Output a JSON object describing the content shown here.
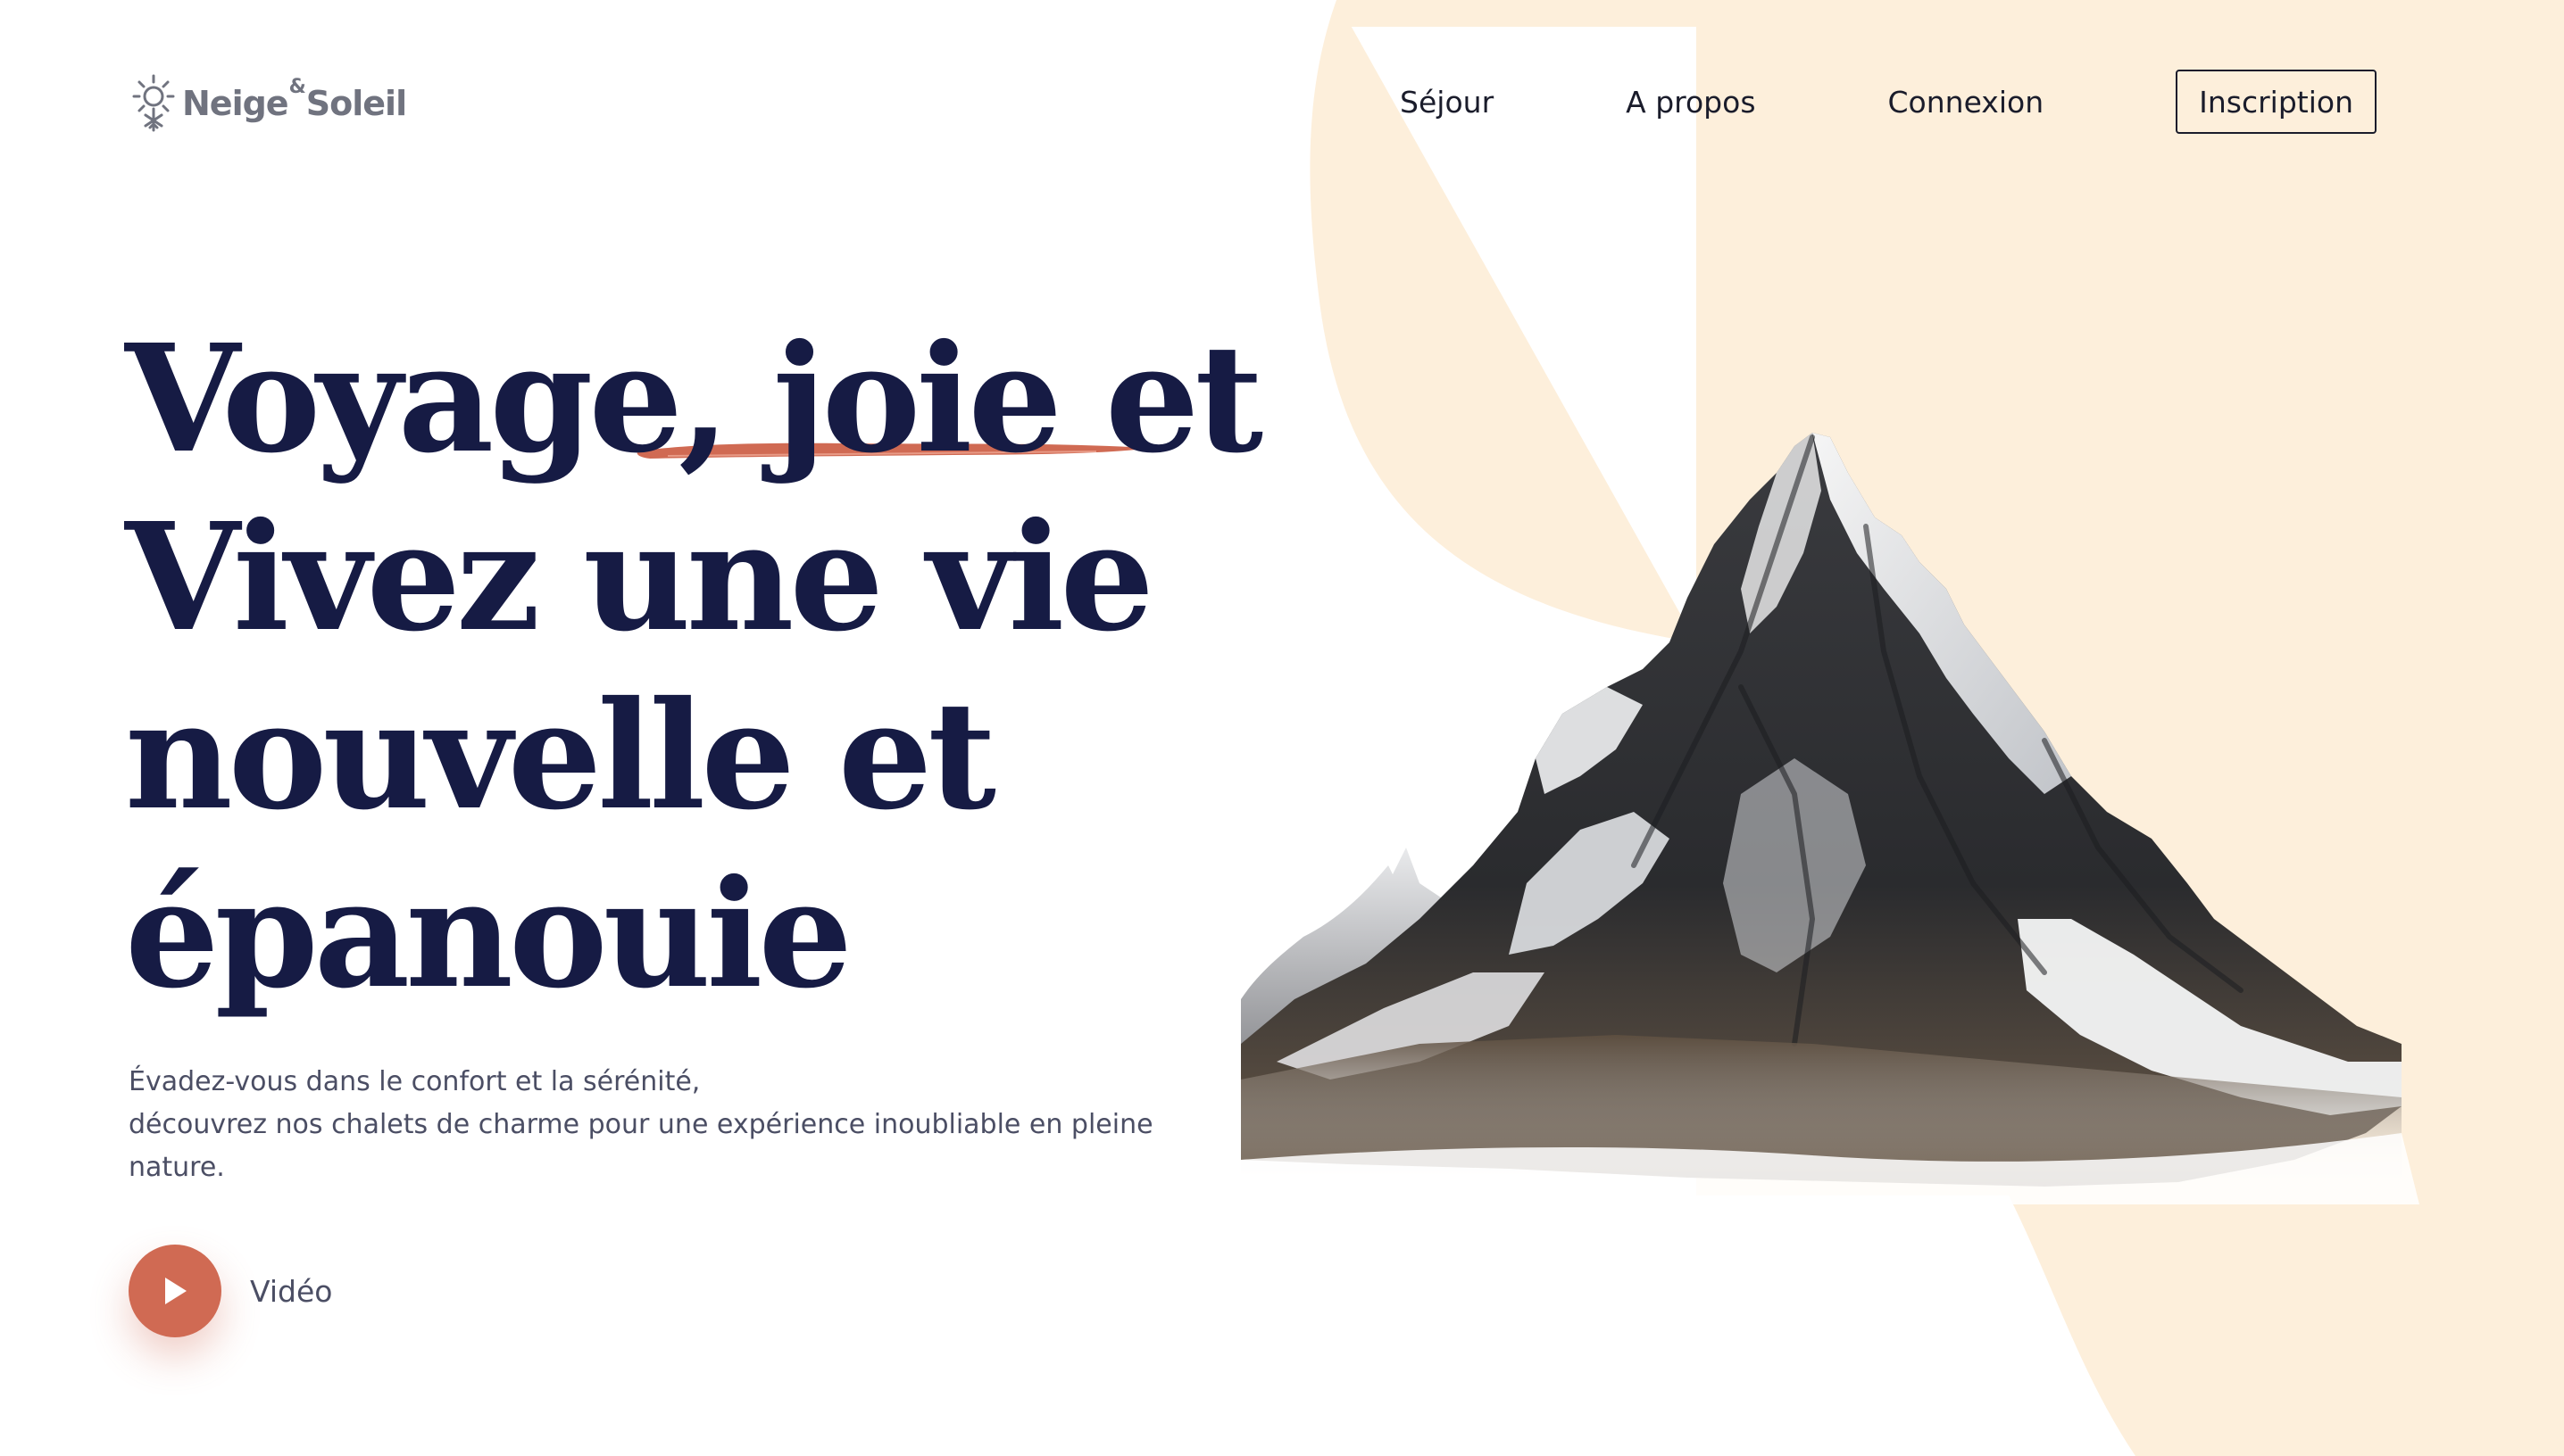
{
  "brand": {
    "name_left": "Neige",
    "name_amp": "&",
    "name_right": "Soleil",
    "icon": "snow-sun-icon"
  },
  "nav": {
    "links": [
      "Séjour",
      "A propos",
      "Connexion"
    ],
    "cta_label": "Inscription"
  },
  "hero": {
    "title_lines": [
      "Voyage, joie et",
      "Vivez une vie",
      "nouvelle et",
      "épanouie"
    ],
    "description_lines": [
      "Évadez-vous dans le confort et la sérénité,",
      "découvrez nos chalets de charme pour une expérience inoubliable en pleine",
      "nature."
    ],
    "video_label": "Vidéo",
    "play_icon": "play-icon",
    "image": "mountain-illustration"
  },
  "colors": {
    "title": "#161b44",
    "accent": "#d06a53",
    "blob": "#fdefdb",
    "body_text": "#4b4e64",
    "logo": "#70737f"
  }
}
